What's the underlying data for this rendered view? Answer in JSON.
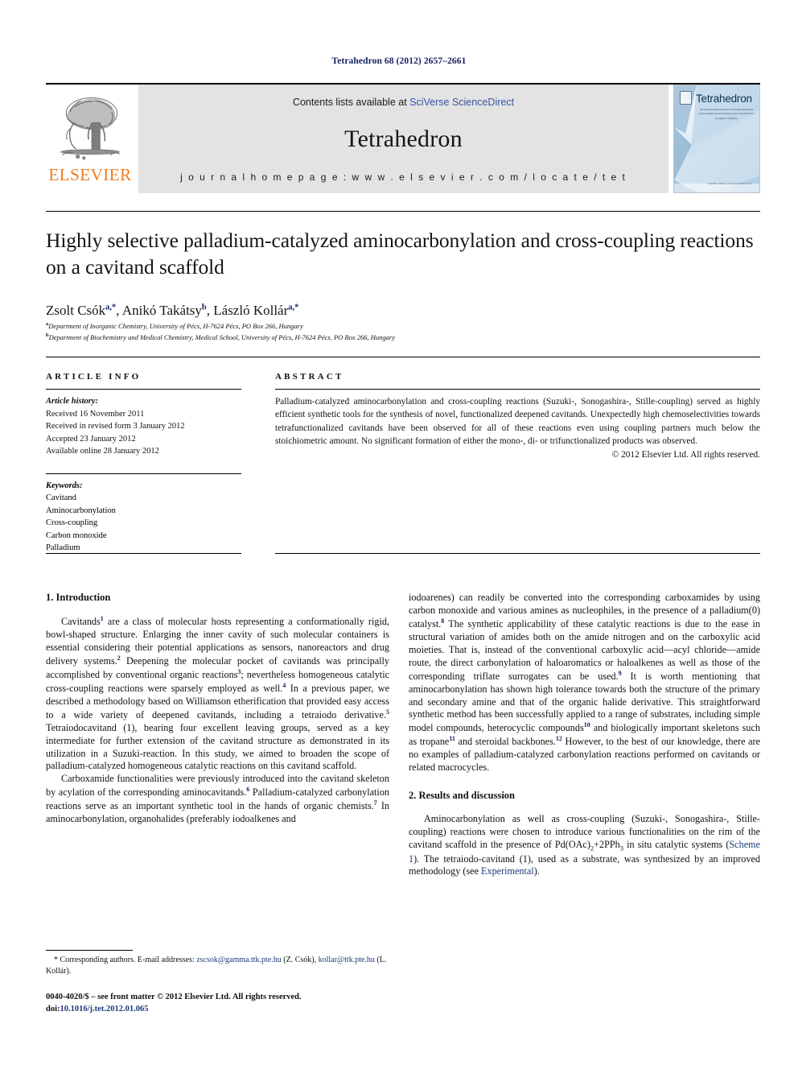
{
  "running_head": "Tetrahedron 68 (2012) 2657–2661",
  "masthead": {
    "publisher_name": "ELSEVIER",
    "contents_prefix": "Contents lists available at ",
    "contents_link": "SciVerse ScienceDirect",
    "journal_name": "Tetrahedron",
    "homepage": "j o u r n a l   h o m e p a g e :   w w w . e l s e v i e r . c o m / l o c a t e / t e t",
    "cover_title": "Tetrahedron",
    "cover_subtitle": "The Internationaal Journal for the Rapid Publication of Full Original Research Papers and Critical Reviews in Organic Chemistry",
    "cover_footer": "Available online at www.sciencedirect.com"
  },
  "article": {
    "title": "Highly selective palladium-catalyzed aminocarbonylation and cross-coupling reactions on a cavitand scaffold",
    "authors": [
      {
        "name": "Zsolt Csók",
        "marks": "a,*"
      },
      {
        "name": "Anikó Takátsy",
        "marks": "b"
      },
      {
        "name": "László Kollár",
        "marks": "a,*"
      }
    ],
    "affiliations": [
      {
        "mark": "a",
        "text": "Department of Inorganic Chemistry, University of Pécs, H-7624 Pécs, PO Box 266, Hungary"
      },
      {
        "mark": "b",
        "text": "Department of Biochemistry and Medical Chemistry, Medical School, University of Pécs, H-7624 Pécs, PO Box 266, Hungary"
      }
    ]
  },
  "article_info": {
    "heading": "ARTICLE INFO",
    "history_label": "Article history:",
    "history": [
      "Received 16 November 2011",
      "Received in revised form 3 January 2012",
      "Accepted 23 January 2012",
      "Available online 28 January 2012"
    ],
    "keywords_label": "Keywords:",
    "keywords": [
      "Cavitand",
      "Aminocarbonylation",
      "Cross-coupling",
      "Carbon monoxide",
      "Palladium"
    ]
  },
  "abstract": {
    "heading": "ABSTRACT",
    "text": "Palladium-catalyzed aminocarbonylation and cross-coupling reactions (Suzuki-, Sonogashira-, Stille-coupling) served as highly efficient synthetic tools for the synthesis of novel, functionalized deepened cavitands. Unexpectedly high chemoselectivities towards tetrafunctionalized cavitands have been observed for all of these reactions even using coupling partners much below the stoichiometric amount. No significant formation of either the mono-, di- or trifunctionalized products was observed.",
    "copyright": "© 2012 Elsevier Ltd. All rights reserved."
  },
  "sections": {
    "introduction_title": "1. Introduction",
    "results_title": "2. Results and discussion"
  },
  "body": {
    "left_p1_a": "Cavitands",
    "left_p1_ref1": "1",
    "left_p1_b": " are a class of molecular hosts representing a conformationally rigid, bowl-shaped structure. Enlarging the inner cavity of such molecular containers is essential considering their potential applications as sensors, nanoreactors and drug delivery systems.",
    "left_p1_ref2": "2",
    "left_p1_c": " Deepening the molecular pocket of cavitands was principally accomplished by conventional organic reactions",
    "left_p1_ref3": "3",
    "left_p1_d": "; nevertheless homogeneous catalytic cross-coupling reactions were sparsely employed as well.",
    "left_p1_ref4": "4",
    "left_p1_e": " In a previous paper, we described a methodology based on Williamson etherification that provided easy access to a wide variety of deepened cavitands, including a tetraiodo derivative.",
    "left_p1_ref5": "5",
    "left_p1_f": " Tetraiodocavitand (1), bearing four excellent leaving groups, served as a key intermediate for further extension of the cavitand structure as demonstrated in its utilization in a Suzuki-reaction. In this study, we aimed to broaden the scope of palladium-catalyzed homogeneous catalytic reactions on this cavitand scaffold.",
    "left_p2_a": "Carboxamide functionalities were previously introduced into the cavitand skeleton by acylation of the corresponding aminocavitands.",
    "left_p2_ref6": "6",
    "left_p2_b": " Palladium-catalyzed carbonylation reactions serve as an important synthetic tool in the hands of organic chemists.",
    "left_p2_ref7": "7",
    "left_p2_c": " In aminocarbonylation, organohalides (preferably iodoalkenes and",
    "right_p1_a": "iodoarenes) can readily be converted into the corresponding carboxamides by using carbon monoxide and various amines as nucleophiles, in the presence of a palladium(0) catalyst.",
    "right_p1_ref8": "8",
    "right_p1_b": " The synthetic applicability of these catalytic reactions is due to the ease in structural variation of amides both on the amide nitrogen and on the carboxylic acid moieties. That is, instead of the conventional carboxylic acid—acyl chloride—amide route, the direct carbonylation of haloaromatics or haloalkenes as well as those of the corresponding triflate surrogates can be used.",
    "right_p1_ref9": "9",
    "right_p1_c": " It is worth mentioning that aminocarbonylation has shown high tolerance towards both the structure of the primary and secondary amine and that of the organic halide derivative. This straightforward synthetic method has been successfully applied to a range of substrates, including simple model compounds, heterocyclic compounds",
    "right_p1_ref10": "10",
    "right_p1_d": " and biologically important skeletons such as tropane",
    "right_p1_ref11": "11",
    "right_p1_e": " and steroidal backbones.",
    "right_p1_ref12": "12",
    "right_p1_f": " However, to the best of our knowledge, there are no examples of palladium-catalyzed carbonylation reactions performed on cavitands or related macrocycles.",
    "right_p2_a": "Aminocarbonylation as well as cross-coupling (Suzuki-, Sonogashira-, Stille-coupling) reactions were chosen to introduce various functionalities on the rim of the cavitand scaffold in the presence of Pd(OAc)",
    "right_p2_sub2": "2",
    "right_p2_b": "+2PPh",
    "right_p2_sub3": "3",
    "right_p2_c": " in situ catalytic systems (",
    "right_p2_link_scheme": "Scheme 1",
    "right_p2_d": "). The tetraiodo-cavitand (1), used as a substrate, was synthesized by an improved methodology (see ",
    "right_p2_link_exp": "Experimental",
    "right_p2_e": ")."
  },
  "footnote": {
    "prefix": "* Corresponding authors. E-mail addresses: ",
    "email1": "zscsok@gamma.ttk.pte.hu",
    "mid1": " (Z. Csók), ",
    "email2": "kollar@ttk.pte.hu",
    "mid2": " (L. Kollár)."
  },
  "imprint": {
    "line1": "0040-4020/$ – see front matter © 2012 Elsevier Ltd. All rights reserved.",
    "doi_label": "doi:",
    "doi_value": "10.1016/j.tet.2012.01.065"
  },
  "colors": {
    "link": "#1b3a7a",
    "sciverse_link": "#3a53a4",
    "elsevier_orange": "#F07B1D",
    "running_head": "#12205e",
    "banner_bg": "#e3e3e3"
  }
}
